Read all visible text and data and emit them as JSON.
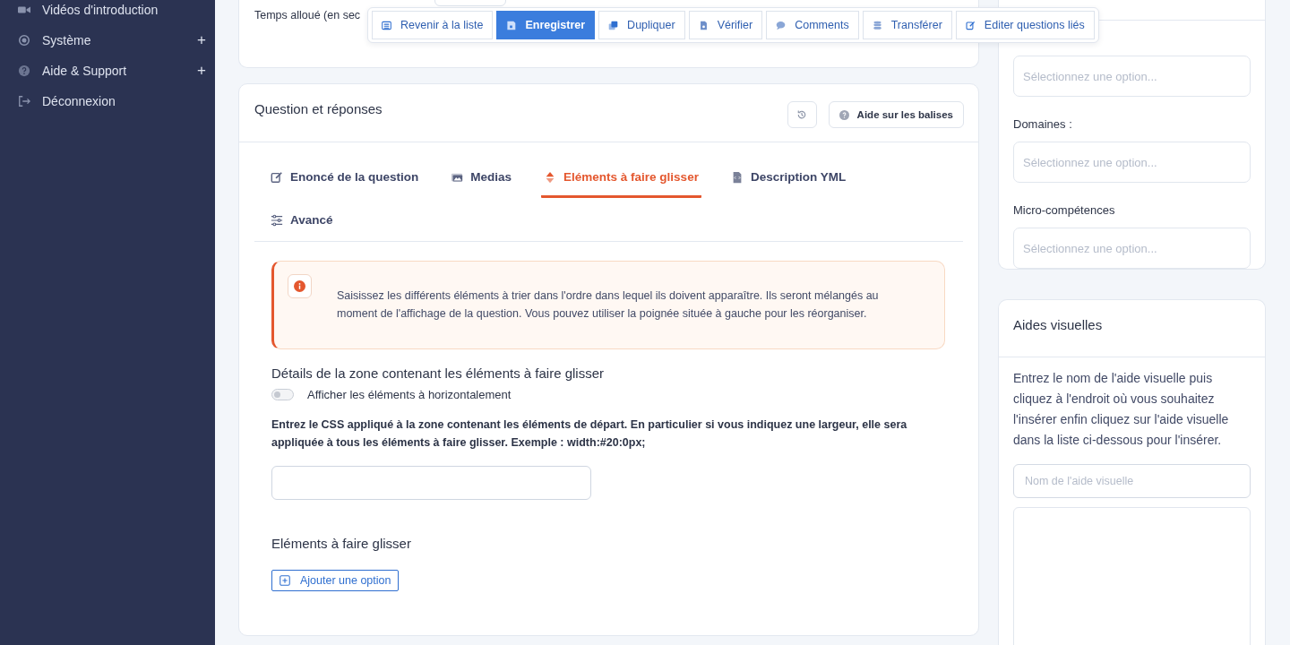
{
  "sidebar": {
    "items": [
      {
        "label": "Vidéos d'introduction"
      },
      {
        "label": "Système",
        "expand_sign": "+"
      },
      {
        "label": "Aide & Support",
        "expand_sign": "+"
      },
      {
        "label": "Déconnexion"
      }
    ]
  },
  "general_card": {
    "field_label": "Temps alloué (en sec"
  },
  "toolbar": [
    {
      "label": "Revenir à la liste",
      "kind": "default"
    },
    {
      "label": "Enregistrer",
      "kind": "primary"
    },
    {
      "label": "Dupliquer",
      "kind": "default"
    },
    {
      "label": "Vérifier",
      "kind": "default"
    },
    {
      "label": "Comments",
      "kind": "default"
    },
    {
      "label": "Transférer",
      "kind": "default"
    },
    {
      "label": "Editer questions liés",
      "kind": "default"
    }
  ],
  "question_card": {
    "title": "Question et réponses",
    "help_button": "Aide sur les balises",
    "tabs": [
      {
        "label": "Enoncé de la question",
        "selected": false
      },
      {
        "label": "Medias",
        "selected": false
      },
      {
        "label": "Eléments à faire glisser",
        "selected": true
      },
      {
        "label": "Description YML",
        "selected": false
      },
      {
        "label": "Avancé",
        "selected": false
      }
    ],
    "alert": "Saisissez les différents éléments à trier dans l'ordre dans lequel ils doivent apparaître. Ils seront mélangés au moment de l'affichage de la question. Vous pouvez utiliser la poignée située à gauche pour les réorganiser.",
    "zone_section": {
      "title": "Détails de la zone contenant les éléments à faire glisser",
      "toggle": {
        "label": "Afficher les éléments à horizontalement",
        "on": false
      },
      "css_label": "Entrez le CSS appliqué à la zone contenant les éléments de départ. En particulier si vous indiquez une largeur, elle sera appliquée à tous les éléments à faire glisser. Exemple : width:#20:0px;"
    },
    "items_section": {
      "title": "Eléments à faire glisser",
      "add_button": "Ajouter une option"
    }
  },
  "filters_card": {
    "fields": [
      {
        "placeholder": "Sélectionnez une option..."
      },
      {
        "label": "Domaines :",
        "placeholder": "Sélectionnez une option..."
      },
      {
        "label": "Micro-compétences",
        "placeholder": "Sélectionnez une option..."
      }
    ]
  },
  "visual_aids_card": {
    "title": "Aides visuelles",
    "instructions": "Entrez le nom de l'aide visuelle puis cliquez à l'endroit où vous souhaitez l'insérer enfin cliquez sur l'aide visuelle dans la liste ci-dessous pour l'insérer.",
    "name_field": {
      "placeholder": "Nom de l'aide visuelle"
    }
  }
}
